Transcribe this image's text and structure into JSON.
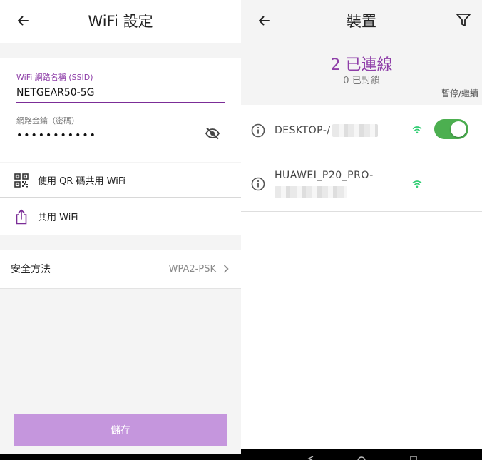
{
  "left": {
    "title": "WiFi 設定",
    "ssid_label": "WiFi 網路名稱 (SSID)",
    "ssid_value": "NETGEAR50-5G",
    "password_label": "網路金鑰（密碼）",
    "password_value": "•••••••••••",
    "qr_share_label": "使用 QR 碼共用 WiFi",
    "share_label": "共用 WiFi",
    "security_label": "安全方法",
    "security_value": "WPA2-PSK",
    "save_label": "儲存"
  },
  "right": {
    "title": "裝置",
    "connected_text": "2 已連線",
    "blocked_text": "0 已封鎖",
    "pause_label": "暫停/繼續",
    "devices": [
      {
        "name": "DESKTOP-/",
        "blocked_enabled": true
      },
      {
        "name": "HUAWEI_P20_PRO-"
      }
    ]
  },
  "colors": {
    "accent_purple": "#8e3ea8",
    "save_button": "#c596dd",
    "wifi_green": "#2ecc71",
    "toggle_on": "#4caf50"
  },
  "icons": [
    "back-arrow-icon",
    "visibility-off-icon",
    "qr-code-icon",
    "share-icon",
    "chevron-right-icon",
    "filter-icon",
    "info-icon",
    "wifi-signal-icon"
  ]
}
